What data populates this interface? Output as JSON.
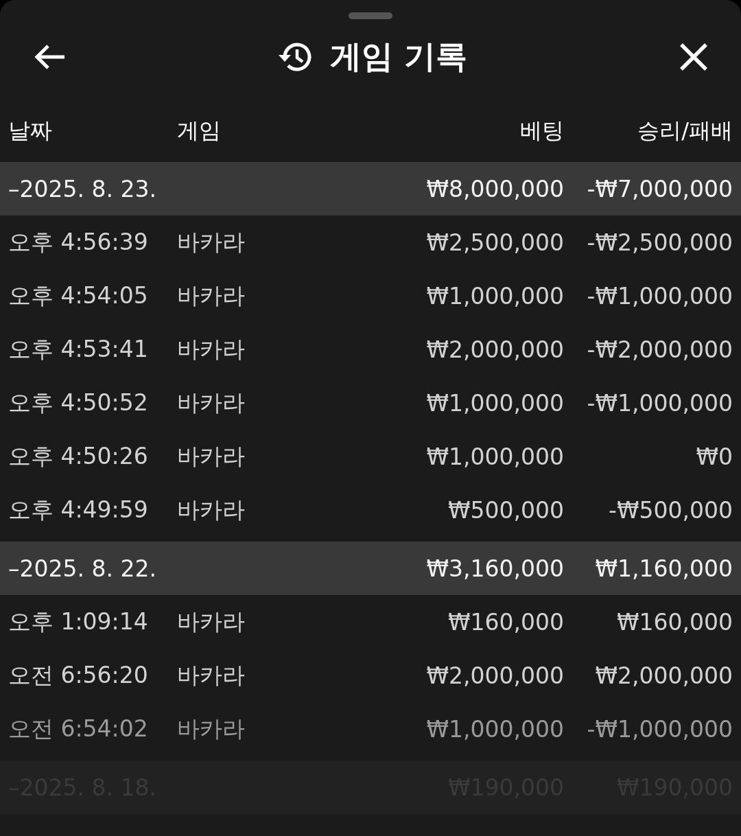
{
  "header": {
    "title": "게임 기록"
  },
  "columns": [
    "날짜",
    "게임",
    "베팅",
    "승리/패배"
  ],
  "groups": [
    {
      "date": "–2025. 8. 23.",
      "bet": "₩8,000,000",
      "result": "-₩7,000,000",
      "rows": [
        {
          "time": "오후 4:56:39",
          "game": "바카라",
          "bet": "₩2,500,000",
          "result": "-₩2,500,000"
        },
        {
          "time": "오후 4:54:05",
          "game": "바카라",
          "bet": "₩1,000,000",
          "result": "-₩1,000,000"
        },
        {
          "time": "오후 4:53:41",
          "game": "바카라",
          "bet": "₩2,000,000",
          "result": "-₩2,000,000"
        },
        {
          "time": "오후 4:50:52",
          "game": "바카라",
          "bet": "₩1,000,000",
          "result": "-₩1,000,000"
        },
        {
          "time": "오후 4:50:26",
          "game": "바카라",
          "bet": "₩1,000,000",
          "result": "₩0"
        },
        {
          "time": "오후 4:49:59",
          "game": "바카라",
          "bet": "₩500,000",
          "result": "-₩500,000"
        }
      ]
    },
    {
      "date": "–2025. 8. 22.",
      "bet": "₩3,160,000",
      "result": "₩1,160,000",
      "rows": [
        {
          "time": "오후 1:09:14",
          "game": "바카라",
          "bet": "₩160,000",
          "result": "₩160,000"
        },
        {
          "time": "오전 6:56:20",
          "game": "바카라",
          "bet": "₩2,000,000",
          "result": "₩2,000,000"
        },
        {
          "time": "오전 6:54:02",
          "game": "바카라",
          "bet": "₩1,000,000",
          "result": "-₩1,000,000"
        }
      ]
    },
    {
      "date": "–2025. 8. 18.",
      "bet": "₩190,000",
      "result": "₩190,000"
    }
  ]
}
